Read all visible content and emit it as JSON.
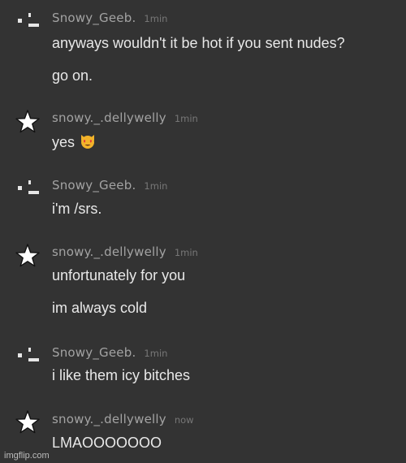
{
  "messages": [
    {
      "author": "Snowy_Geeb.",
      "avatar_icon": "dotted-face-icon",
      "time": "1min",
      "lines": [
        "anyways wouldn't it be hot if you sent nudes?",
        "go on."
      ]
    },
    {
      "author": "snowy._.dellywelly",
      "avatar_icon": "star-icon",
      "time": "1min",
      "lines": [
        "yes"
      ],
      "emoji": "heart-eyes-cat-icon"
    },
    {
      "author": "Snowy_Geeb.",
      "avatar_icon": "dotted-face-icon",
      "time": "1min",
      "lines": [
        "i'm /srs."
      ]
    },
    {
      "author": "snowy._.dellywelly",
      "avatar_icon": "star-icon",
      "time": "1min",
      "lines": [
        "unfortunately for you",
        "im always cold"
      ]
    },
    {
      "author": "Snowy_Geeb.",
      "avatar_icon": "dotted-face-icon",
      "time": "1min",
      "lines": [
        "i like them icy bitches"
      ]
    },
    {
      "author": "snowy._.dellywelly",
      "avatar_icon": "star-icon",
      "time": "now",
      "lines": [
        "LMAOOOOOOO"
      ]
    }
  ],
  "watermark": "imgflip.com"
}
